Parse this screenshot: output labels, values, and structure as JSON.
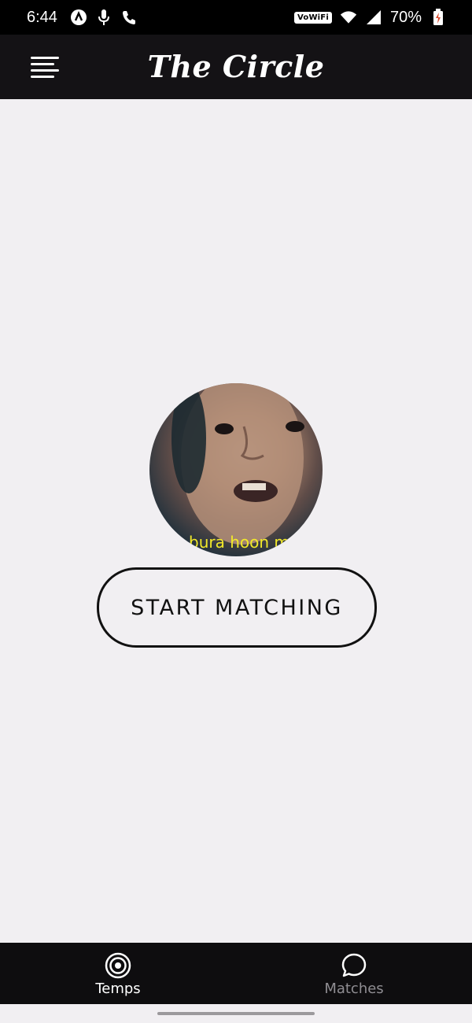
{
  "status_bar": {
    "time": "6:44",
    "wifi_label": "VoWiFi",
    "battery": "70%",
    "icons": [
      "app-notification-icon",
      "microphone-icon",
      "phone-icon",
      "wifi-icon",
      "cell-signal-icon",
      "battery-charging-icon"
    ]
  },
  "app_bar": {
    "title": "The Circle",
    "menu_icon": "menu-icon"
  },
  "main": {
    "avatar_caption": "bura hoon m",
    "start_button_label": "START MATCHING"
  },
  "bottom_nav": {
    "tabs": [
      {
        "label": "Temps",
        "icon": "target-icon",
        "active": true
      },
      {
        "label": "Matches",
        "icon": "chat-bubble-icon",
        "active": false
      }
    ]
  },
  "colors": {
    "background": "#f1eff2",
    "bar": "#141215",
    "caption": "#f2e92a",
    "inactive_tab": "#8f8d92"
  }
}
